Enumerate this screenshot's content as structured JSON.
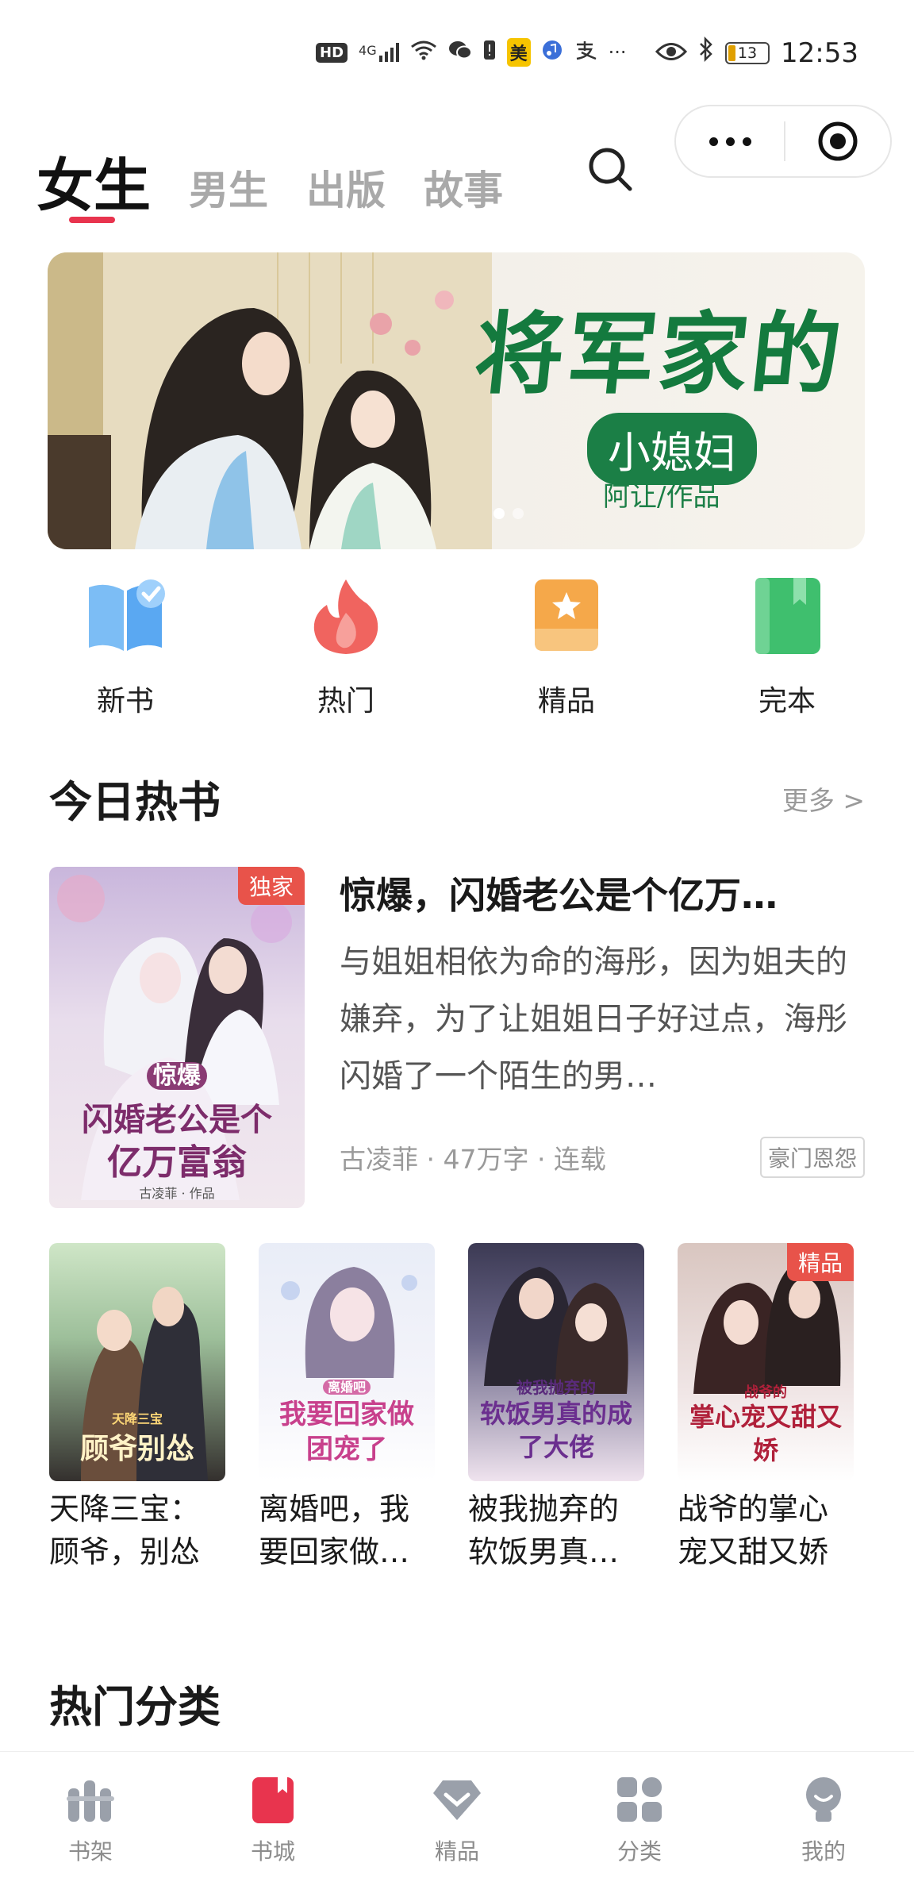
{
  "status_bar": {
    "hd": "HD",
    "signal": "4G",
    "app_badge": "美",
    "time": "12:53",
    "battery": "13"
  },
  "nav": {
    "tabs": [
      {
        "label": "女生",
        "active": true
      },
      {
        "label": "男生",
        "active": false
      },
      {
        "label": "出版",
        "active": false
      },
      {
        "label": "故事",
        "active": false
      }
    ]
  },
  "banner": {
    "title": "将军家的",
    "subtitle": "小媳妇",
    "author": "阿让/作品",
    "slide_count": 2,
    "active_slide": 1
  },
  "quick_categories": [
    {
      "label": "新书",
      "icon": "new-book-icon",
      "color": "#5aa8f2"
    },
    {
      "label": "热门",
      "icon": "flame-icon",
      "color": "#f0645f"
    },
    {
      "label": "精品",
      "icon": "star-badge-icon",
      "color": "#f5a84a"
    },
    {
      "label": "完本",
      "icon": "finished-book-icon",
      "color": "#3fbf6e"
    }
  ],
  "today_hot": {
    "title": "今日热书",
    "more": "更多 >"
  },
  "featured_book": {
    "badge": "独家",
    "cover_line1": "惊爆",
    "cover_line2": "闪婚老公是个",
    "cover_line3": "亿万富翁",
    "cover_author": "古凌菲 · 作品",
    "title": "惊爆，闪婚老公是个亿万…",
    "description": "与姐姐相依为命的海彤，因为姐夫的嫌弃，为了让姐姐日子好过点，海彤闪婚了一个陌生的男…",
    "meta": "古凌菲 · 47万字 · 连载",
    "tag": "豪门恩怨"
  },
  "books": [
    {
      "title": "天降三宝：顾爷，别怂",
      "cover_text": "顾爷别怂",
      "cover_sub": "天降三宝",
      "badge": ""
    },
    {
      "title": "离婚吧，我要回家做…",
      "cover_text": "我要回家做团宠了",
      "cover_sub": "离婚吧",
      "badge": ""
    },
    {
      "title": "被我抛弃的软饭男真…",
      "cover_text": "软饭男真的成了大佬",
      "cover_sub": "被我抛弃的",
      "badge": ""
    },
    {
      "title": "战爷的掌心宠又甜又娇",
      "cover_text": "掌心宠又甜又娇",
      "cover_sub": "战爷的",
      "badge": "精品"
    }
  ],
  "hot_categories": {
    "title": "热门分类"
  },
  "bottom_nav": [
    {
      "label": "书架",
      "icon": "bookshelf-icon",
      "active": false
    },
    {
      "label": "书城",
      "icon": "bookstore-icon",
      "active": true
    },
    {
      "label": "精品",
      "icon": "diamond-icon",
      "active": false
    },
    {
      "label": "分类",
      "icon": "grid-icon",
      "active": false
    },
    {
      "label": "我的",
      "icon": "profile-icon",
      "active": false
    }
  ],
  "colors": {
    "accent": "#e8344e",
    "banner_green": "#1b7f46",
    "badge_red": "#e8534a"
  }
}
